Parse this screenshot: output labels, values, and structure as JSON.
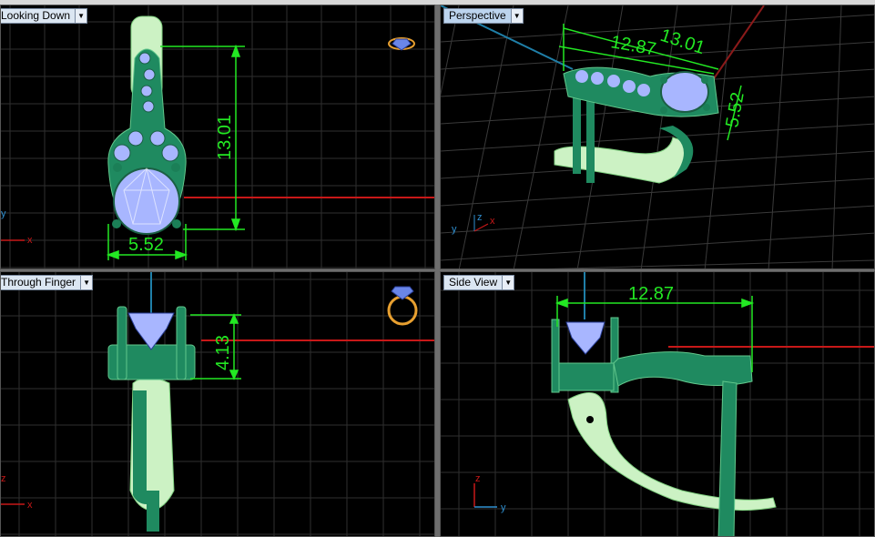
{
  "viewports": {
    "top_left": {
      "title": "Looking Down",
      "dims": {
        "length": "13.01",
        "width": "5.52"
      }
    },
    "top_right": {
      "title": "Perspective",
      "dims": {
        "length": "12.87",
        "diag": "13.01",
        "width": "5.52"
      }
    },
    "bottom_left": {
      "title": "Through Finger",
      "dims": {
        "height": "4.13"
      }
    },
    "bottom_right": {
      "title": "Side View",
      "dims": {
        "length": "12.87"
      }
    }
  },
  "axes": {
    "x": "x",
    "y": "y",
    "z": "z"
  },
  "icons": [
    "diamond-icon",
    "ring-icon",
    "dropdown-arrow-icon"
  ],
  "colors": {
    "background": "#000000",
    "grid": "#2f2f2f",
    "model_green": "#1f8a60",
    "model_light": "#ccf2c4",
    "gem": "#a8b6ff",
    "dimension": "#23e823",
    "x_axis": "#c81818",
    "z_axis": "#1f7fa8",
    "label_bg": "#dbe6f2"
  }
}
